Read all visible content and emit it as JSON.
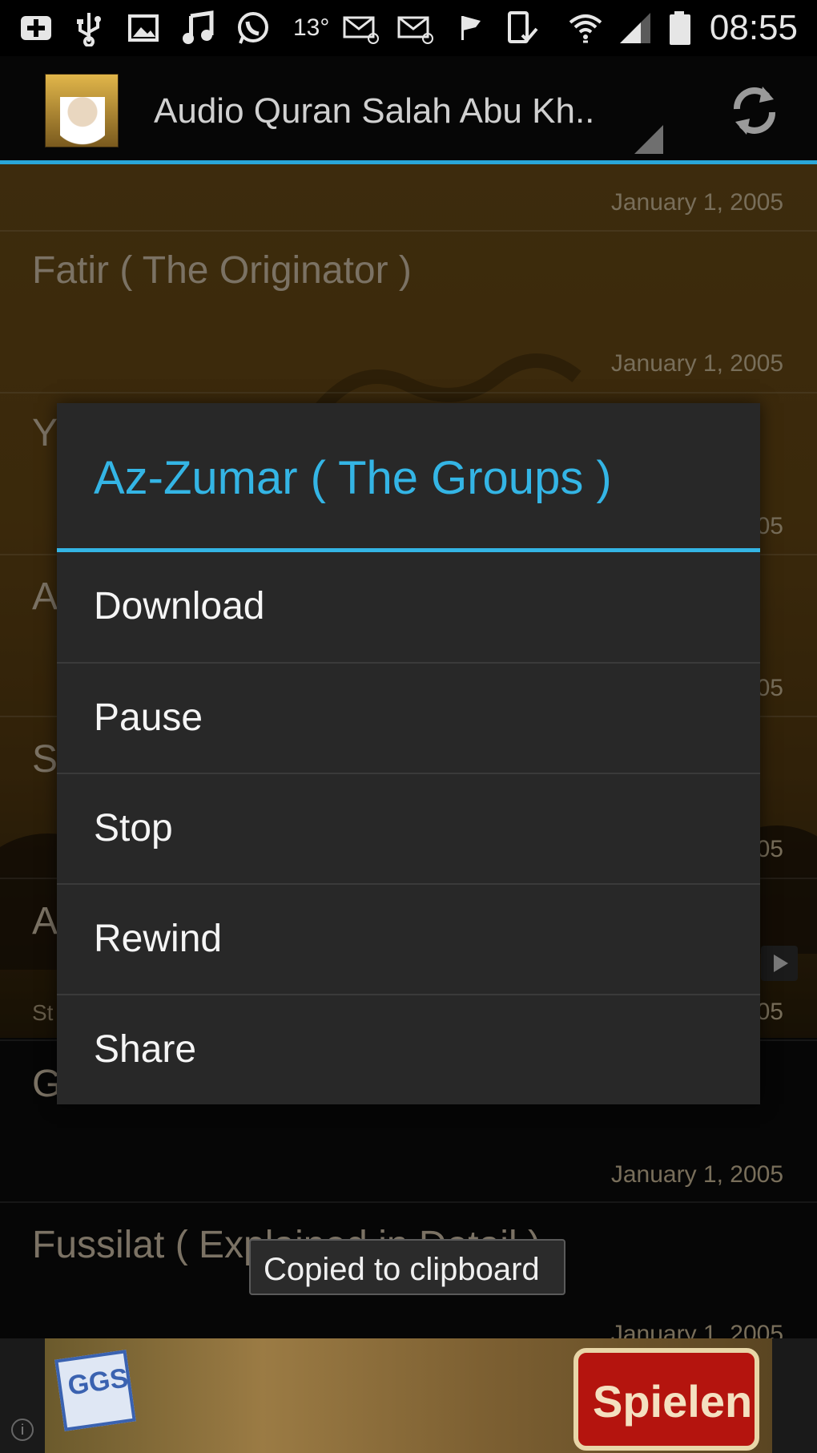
{
  "status_bar": {
    "temperature": "13°",
    "time": "08:55"
  },
  "action_bar": {
    "title": "Audio Quran Salah Abu Kh.."
  },
  "list": {
    "items": [
      {
        "date": "January 1, 2005",
        "title": "Fatir ( The Originator )"
      },
      {
        "date": "January 1, 2005",
        "title": "Y"
      },
      {
        "date": "…05",
        "title": "A"
      },
      {
        "date": "…05",
        "title": "S"
      },
      {
        "date": "…05",
        "title": "A"
      },
      {
        "date": "…05",
        "title": "G",
        "subtitle": "St"
      },
      {
        "date": "January 1, 2005",
        "title": "Fussilat ( Explained in Detail )"
      },
      {
        "date": "January 1, 2005",
        "title": ""
      }
    ]
  },
  "dialog": {
    "title": "Az-Zumar ( The Groups )",
    "options": [
      "Download",
      "Pause",
      "Stop",
      "Rewind",
      "Share"
    ]
  },
  "toast": {
    "text": "Copied to clipboard"
  },
  "ad": {
    "logo_text": "GGS",
    "button_label": "Spielen",
    "info": "i"
  }
}
